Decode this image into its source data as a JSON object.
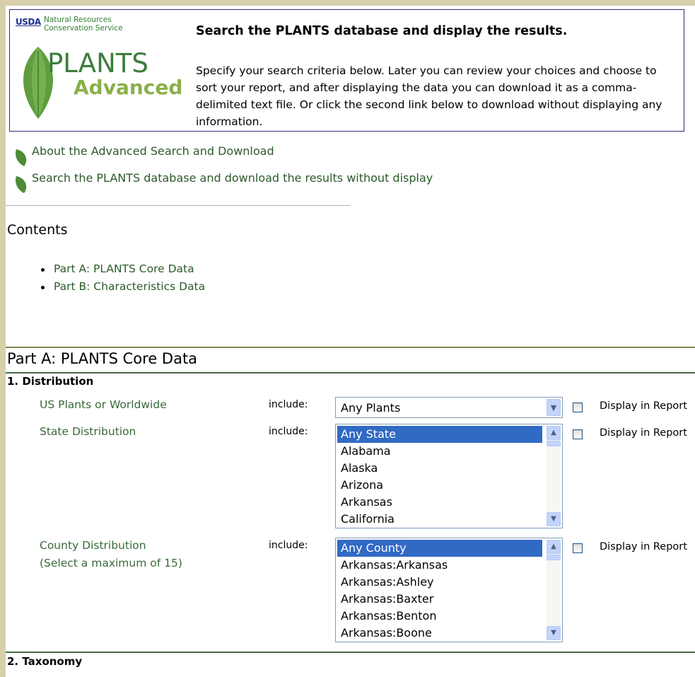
{
  "header": {
    "usda": "USDA",
    "agency_line1": "Natural Resources",
    "agency_line2": "Conservation Service",
    "logo_word1": "PLANTS",
    "logo_word2": "Advanced",
    "title": "Search the PLANTS database and display the results.",
    "description": "Specify your search criteria below. Later you can review your choices and choose to sort your report, and after displaying the data you can download it as a comma-delimited text file. Or click the second link below to download without displaying any information."
  },
  "links": {
    "about": "About the Advanced Search and Download",
    "download": "Search the PLANTS database and download the results without display"
  },
  "contents": {
    "heading": "Contents",
    "items": [
      "Part A: PLANTS Core Data",
      "Part B: Characteristics Data"
    ]
  },
  "part_a": {
    "heading": "Part A: PLANTS Core Data",
    "section1": "1. Distribution",
    "section2": "2. Taxonomy",
    "include_label": "include:",
    "display_label": "Display in Report",
    "rows": {
      "us_plants": {
        "label": "US Plants or Worldwide",
        "selected": "Any Plants"
      },
      "state": {
        "label": "State Distribution",
        "options": [
          "Any State",
          "Alabama",
          "Alaska",
          "Arizona",
          "Arkansas",
          "California"
        ]
      },
      "county": {
        "label": "County Distribution",
        "sublabel": "(Select a maximum of 15)",
        "options": [
          "Any County",
          "Arkansas:Arkansas",
          "Arkansas:Ashley",
          "Arkansas:Baxter",
          "Arkansas:Benton",
          "Arkansas:Boone"
        ]
      }
    }
  },
  "colors": {
    "background": "#d6cfa9",
    "link": "#2b5a2b",
    "selection": "#316ac5",
    "header_border": "#2a2e78"
  },
  "icons": [
    "leaf-icon",
    "chevron-down-icon",
    "chevron-up-icon"
  ]
}
